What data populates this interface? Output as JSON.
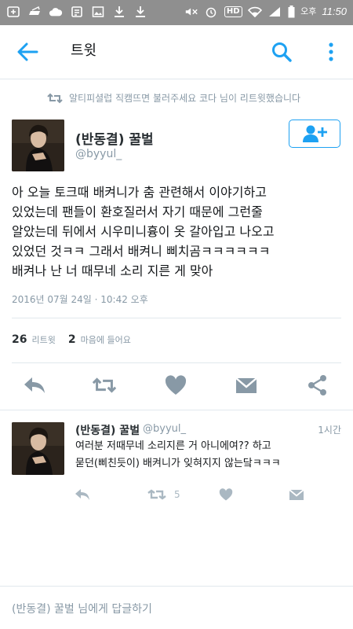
{
  "status_bar": {
    "time": "11:50",
    "ampm": "오후",
    "hd_label": "HD"
  },
  "header": {
    "title": "트윗"
  },
  "retweet_context": "알티피셜럽 직캠뜨면 불러주세요 코다 님이 리트윗했습니다",
  "tweet": {
    "name": "(반동결) 꿀벌",
    "handle": "@byyul_",
    "lines": [
      "아 오늘 토크때 배켜니가 춤 관련해서 이야기하고",
      "있었는데 팬들이 환호질러서 자기 때문에 그런줄",
      "알았는데 뒤에서 시우미니흉이 옷 갈아입고 나오고",
      "있었던 것ㅋㅋ 그래서 배켜니 삐치곰ㅋㅋㅋㅋㅋㅋ",
      "배켜나 난 너 때무네 소리 지른 게 맞아"
    ],
    "date": "2016년 07월 24일 · 10:42 오후",
    "retweet_count": "26",
    "retweet_label": "리트윗",
    "like_count": "2",
    "like_label": "마음에 들어요"
  },
  "reply": {
    "name": "(반동결) 꿀벌",
    "handle": "@byyul_",
    "time": "1시간",
    "lines": [
      "여러분 저때무네 소리지른 거 아니에여?? 하고",
      "묻던(삐친듯이) 배켜니가 잊혀지지 않는닼ㅋㅋㅋ"
    ],
    "retweet_count": "5"
  },
  "reply_prompt": "(반동결) 꿀벌 님에게 답글하기",
  "colors": {
    "accent": "#1da1f2",
    "icon_gray": "#8899a6",
    "status_bar": "#8f8f8f"
  },
  "icons": [
    "back-arrow-icon",
    "search-icon",
    "more-vertical-icon",
    "retweet-icon",
    "follow-user-icon",
    "reply-icon",
    "heart-icon",
    "message-icon",
    "share-icon"
  ]
}
